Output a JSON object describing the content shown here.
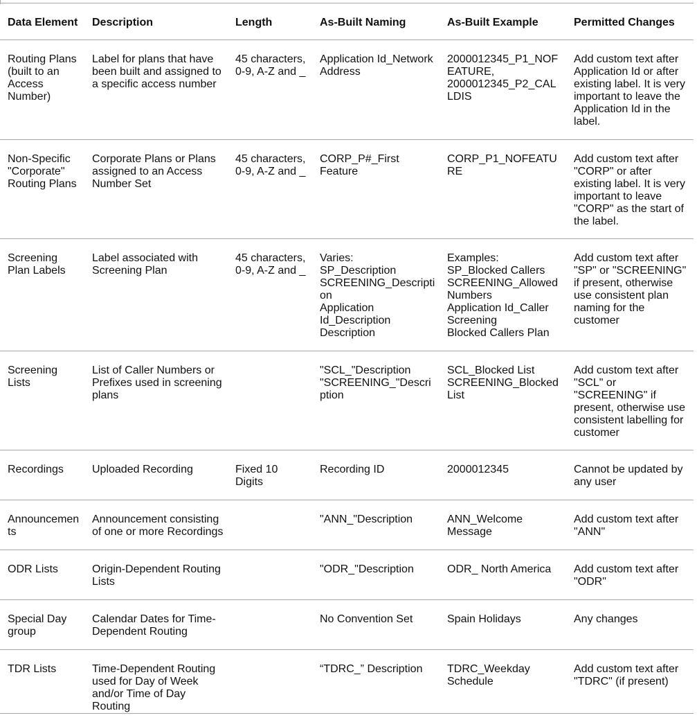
{
  "table": {
    "headers": [
      "Data Element",
      "Description",
      "Length",
      "As-Built Naming",
      "As-Built Example",
      "Permitted Changes"
    ],
    "rows": [
      {
        "data_element": "Routing Plans (built to an Access Number)",
        "description": "Label for plans that have been built and assigned to a specific access number",
        "length": "45 characters, 0-9, A-Z and _",
        "as_built_naming": "Application Id_Network Address",
        "as_built_example": "2000012345_P1_NOFEATURE, 2000012345_P2_CALLDIS",
        "permitted_changes": "Add custom text after Application Id or after existing label. It is very important to leave the Application Id in the label."
      },
      {
        "data_element": "Non-Specific \"Corporate\" Routing Plans",
        "description": "Corporate Plans or Plans assigned to an Access Number Set",
        "length": "45 characters, 0-9, A-Z and _",
        "as_built_naming": "CORP_P#_First Feature",
        "as_built_example": "CORP_P1_NOFEATURE",
        "permitted_changes": "Add custom text after \"CORP\" or after existing label. It is very important to leave \"CORP\" as the start of the label."
      },
      {
        "data_element": "Screening Plan Labels",
        "description": "Label associated with Screening Plan",
        "length": "45 characters, 0-9, A-Z and _",
        "as_built_naming": "Varies:\nSP_Description\nSCREENING_Description\nApplication Id_Description\nDescription",
        "as_built_example": "Examples:\nSP_Blocked Callers\nSCREENING_Allowed Numbers\nApplication Id_Caller Screening\nBlocked Callers Plan",
        "permitted_changes": "Add custom text after \"SP\" or \"SCREENING\" if present, otherwise use consistent plan naming for the customer"
      },
      {
        "data_element": "Screening Lists",
        "description": "List of Caller Numbers or Prefixes used in screening plans",
        "length": "",
        "as_built_naming": "\"SCL_\"Description\n\"SCREENING_\"Description",
        "as_built_example": "SCL_Blocked List\nSCREENING_Blocked List",
        "permitted_changes": "Add custom text after \"SCL\" or \"SCREENING\" if present, otherwise use consistent labelling for customer"
      },
      {
        "data_element": "Recordings",
        "description": "Uploaded Recording",
        "length": "Fixed 10 Digits",
        "as_built_naming": "Recording ID",
        "as_built_example": "2000012345",
        "permitted_changes": "Cannot be updated by any user"
      },
      {
        "data_element": "Announcements",
        "description": "Announcement consisting of one or more Recordings",
        "length": "",
        "as_built_naming": "\"ANN_\"Description",
        "as_built_example": "ANN_Welcome Message",
        "permitted_changes": "Add custom text after \"ANN\""
      },
      {
        "data_element": "ODR Lists",
        "description": "Origin-Dependent Routing Lists",
        "length": "",
        "as_built_naming": "\"ODR_\"Description",
        "as_built_example": "ODR_ North America",
        "permitted_changes": "Add custom text after \"ODR\""
      },
      {
        "data_element": "Special Day group",
        "description": "Calendar Dates for Time-Dependent Routing",
        "length": "",
        "as_built_naming": "No Convention Set",
        "as_built_example": "Spain Holidays",
        "permitted_changes": "Any changes"
      },
      {
        "data_element": "TDR Lists",
        "description": "Time-Dependent Routing used for Day of Week and/or Time of Day Routing",
        "length": "",
        "as_built_naming": "“TDRC_” Description",
        "as_built_example": "TDRC_Weekday Schedule",
        "permitted_changes": "Add custom text after \"TDRC\" (if present)"
      }
    ]
  }
}
